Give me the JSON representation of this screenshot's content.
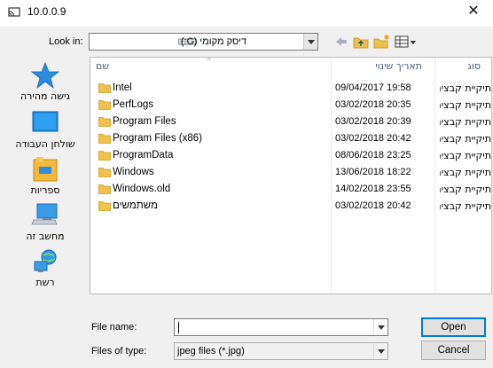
{
  "window": {
    "title": "10.0.0.9",
    "close_glyph": "✕"
  },
  "toolbar": {
    "look_in_label": "Look in:",
    "look_in_value": "דיסק מקומי (C:)",
    "back_icon": "back-arrow-icon",
    "up_icon": "up-folder-icon",
    "new_folder_icon": "new-folder-icon",
    "view_menu_icon": "view-menu-icon"
  },
  "places": [
    {
      "label": "גישה מהירה",
      "icon": "star-icon"
    },
    {
      "label": "שולחן העבודה",
      "icon": "desktop-icon"
    },
    {
      "label": "ספריות",
      "icon": "libraries-icon"
    },
    {
      "label": "מחשב זה",
      "icon": "computer-icon"
    },
    {
      "label": "רשת",
      "icon": "network-icon"
    }
  ],
  "columns": {
    "name": "שם",
    "date": "תאריך שינוי",
    "type": "סוג"
  },
  "files": [
    {
      "name": "Intel",
      "date": "09/04/2017 19:58",
      "type": "תיקיית קבצים"
    },
    {
      "name": "PerfLogs",
      "date": "03/02/2018 20:35",
      "type": "תיקיית קבצים"
    },
    {
      "name": "Program Files",
      "date": "03/02/2018 20:39",
      "type": "תיקיית קבצים"
    },
    {
      "name": "Program Files (x86)",
      "date": "03/02/2018 20:42",
      "type": "תיקיית קבצים"
    },
    {
      "name": "ProgramData",
      "date": "08/06/2018 23:25",
      "type": "תיקיית קבצים"
    },
    {
      "name": "Windows",
      "date": "13/06/2018 18:22",
      "type": "תיקיית קבצים"
    },
    {
      "name": "Windows.old",
      "date": "14/02/2018 23:55",
      "type": "תיקיית קבצים"
    },
    {
      "name": "משתמשים",
      "date": "03/02/2018 20:42",
      "type": "תיקיית קבצים"
    }
  ],
  "form": {
    "file_name_label": "File name:",
    "file_name_value": "",
    "files_of_type_label": "Files of type:",
    "files_of_type_value": "jpeg files (*.jpg)"
  },
  "buttons": {
    "open": "Open",
    "cancel": "Cancel"
  },
  "colors": {
    "accent": "#0078d7",
    "folder": "#f0c24a",
    "header_text": "#4c607a"
  }
}
